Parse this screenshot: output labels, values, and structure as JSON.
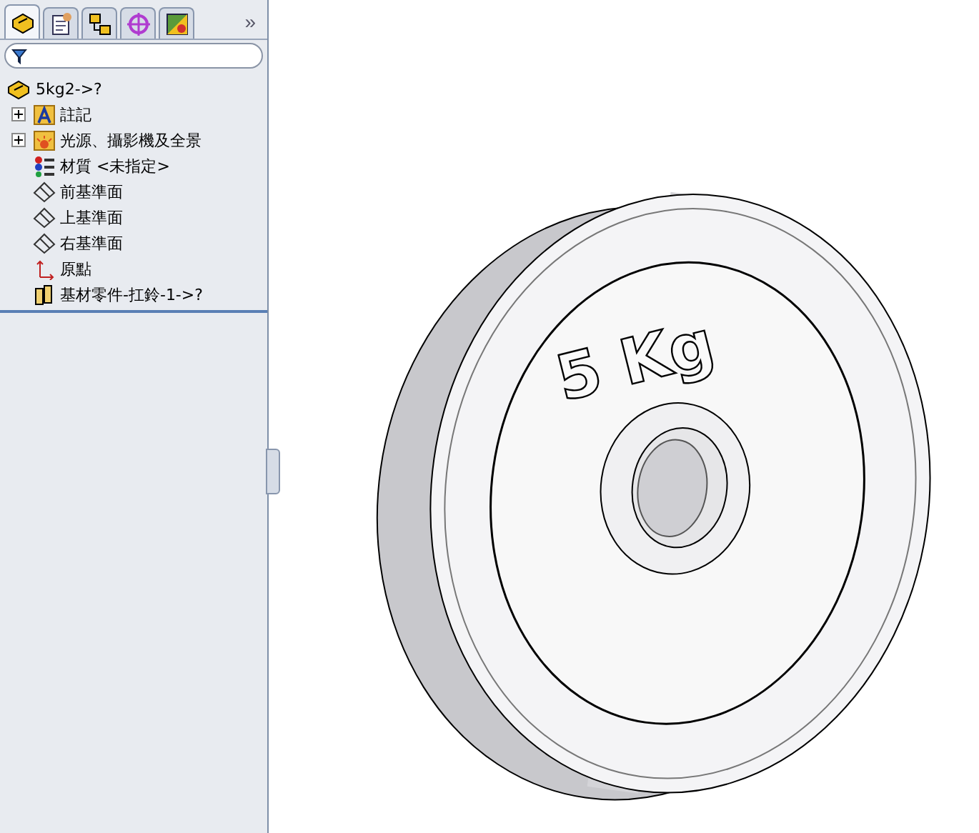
{
  "panel_tabs": [
    {
      "kind": "part",
      "selected": true
    },
    {
      "kind": "property",
      "selected": false
    },
    {
      "kind": "config",
      "selected": false
    },
    {
      "kind": "target",
      "selected": false
    },
    {
      "kind": "display",
      "selected": false
    }
  ],
  "more_tabs": "»",
  "tree": {
    "label": "5kg2->?",
    "kind": "part",
    "children": [
      {
        "label": "註記",
        "kind": "annotation",
        "expanded": false
      },
      {
        "label": "光源、攝影機及全景",
        "kind": "lights",
        "expanded": false
      },
      {
        "label": "材質 <未指定>",
        "kind": "material"
      },
      {
        "label": "前基準面",
        "kind": "plane"
      },
      {
        "label": "上基準面",
        "kind": "plane"
      },
      {
        "label": "右基準面",
        "kind": "plane"
      },
      {
        "label": "原點",
        "kind": "origin"
      },
      {
        "label": "基材零件-扛鈴-1->?",
        "kind": "base"
      }
    ]
  },
  "model": {
    "label": "5 Kg"
  }
}
